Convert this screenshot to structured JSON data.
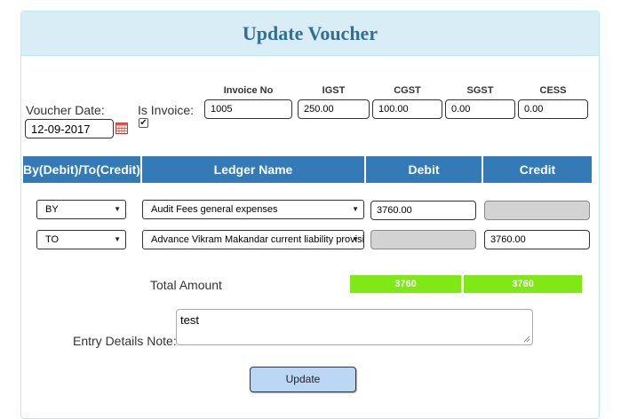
{
  "panel": {
    "title": "Update Voucher"
  },
  "voucher": {
    "date_label": "Voucher Date:",
    "date_value": "12-09-2017",
    "is_invoice_label": "Is Invoice:",
    "is_invoice_checked": true
  },
  "invoice_fields": {
    "invoice_no": {
      "label": "Invoice No",
      "value": "1005"
    },
    "igst": {
      "label": "IGST",
      "value": "250.00"
    },
    "cgst": {
      "label": "CGST",
      "value": "100.00"
    },
    "sgst": {
      "label": "SGST",
      "value": "0.00"
    },
    "cess": {
      "label": "CESS",
      "value": "0.00"
    }
  },
  "table": {
    "headers": [
      "By(Debit)/To(Credit)",
      "Ledger Name",
      "Debit",
      "Credit"
    ],
    "rows": [
      {
        "type": "BY",
        "ledger": "Audit Fees general expenses",
        "debit": "3760.00",
        "credit": ""
      },
      {
        "type": "TO",
        "ledger": "Advance Vikram Makandar current liability provision",
        "debit": "",
        "credit": "3760.00"
      }
    ]
  },
  "totals": {
    "label": "Total Amount",
    "debit": "3760",
    "credit": "3760"
  },
  "entry_note": {
    "label": "Entry Details Note:",
    "value": "test"
  },
  "actions": {
    "update_label": "Update"
  },
  "colors": {
    "header_bg": "#d9edf7",
    "header_text": "#31708f",
    "table_head": "#337ab7",
    "total_green": "#7fe817",
    "button_bg": "#bcd7f5"
  }
}
